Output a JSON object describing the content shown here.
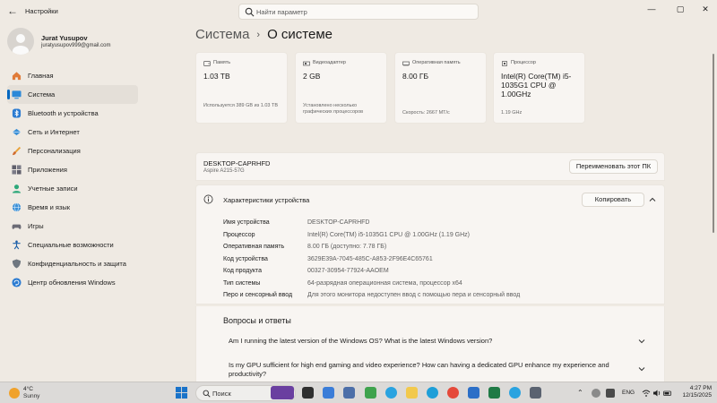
{
  "titlebar": {
    "app_title": "Настройки",
    "search_placeholder": "Найти параметр"
  },
  "profile": {
    "name": "Jurat Yusupov",
    "email": "juratyusupov999@gmail.com"
  },
  "sidebar": {
    "items": [
      {
        "label": "Главная",
        "icon": "home-icon"
      },
      {
        "label": "Система",
        "icon": "system-icon",
        "active": true
      },
      {
        "label": "Bluetooth и устройства",
        "icon": "bluetooth-icon"
      },
      {
        "label": "Сеть и Интернет",
        "icon": "network-icon"
      },
      {
        "label": "Персонализация",
        "icon": "brush-icon"
      },
      {
        "label": "Приложения",
        "icon": "apps-icon"
      },
      {
        "label": "Учетные записи",
        "icon": "accounts-icon"
      },
      {
        "label": "Время и язык",
        "icon": "globe-icon"
      },
      {
        "label": "Игры",
        "icon": "gamepad-icon"
      },
      {
        "label": "Специальные возможности",
        "icon": "accessibility-icon"
      },
      {
        "label": "Конфиденциальность и защита",
        "icon": "shield-icon"
      },
      {
        "label": "Центр обновления Windows",
        "icon": "update-icon"
      }
    ]
  },
  "breadcrumb": {
    "parent": "Система",
    "separator": "›",
    "current": "О системе"
  },
  "cards": [
    {
      "label": "Память",
      "value": "1.03 TB",
      "sub": "Используется 389 GB из 1.03 TB",
      "icon": "storage-icon"
    },
    {
      "label": "Видеоадаптер",
      "value": "2 GB",
      "sub": "Установлено несколько графических процессоров",
      "icon": "gpu-icon"
    },
    {
      "label": "Оперативная память",
      "value": "8.00 ГБ",
      "sub": "Скорость: 2667 МТ/с",
      "icon": "ram-icon"
    },
    {
      "label": "Процессор",
      "value": "Intel(R) Core(TM) i5-1035G1 CPU @ 1.00GHz",
      "sub": "1.19 GHz",
      "icon": "cpu-icon"
    }
  ],
  "device": {
    "name": "DESKTOP-CAPRHFD",
    "model": "Aspire A215-57G",
    "rename_button": "Переименовать этот ПК"
  },
  "specs": {
    "title": "Характеристики устройства",
    "copy_button": "Копировать",
    "rows": [
      {
        "key": "Имя устройства",
        "value": "DESKTOP-CAPRHFD"
      },
      {
        "key": "Процессор",
        "value": "Intel(R) Core(TM) i5-1035G1 CPU @ 1.00GHz (1.19 GHz)"
      },
      {
        "key": "Оперативная память",
        "value": "8.00 ГБ (доступно: 7.78 ГБ)"
      },
      {
        "key": "Код устройства",
        "value": "3629E39A-7045-485C-A853-2F96E4C65761"
      },
      {
        "key": "Код продукта",
        "value": "00327-30954-77924-AAOEM"
      },
      {
        "key": "Тип системы",
        "value": "64-разрядная операционная система, процессор x64"
      },
      {
        "key": "Перо и сенсорный ввод",
        "value": "Для этого монитора недоступен ввод с помощью пера и сенсорный ввод"
      }
    ]
  },
  "faq": {
    "title": "Вопросы и ответы",
    "questions": [
      "Am I running the latest version of the Windows OS? What is the latest Windows version?",
      "Is my GPU sufficient for high end gaming and video experience? How can having a dedicated GPU enhance my experience and productivity?"
    ]
  },
  "taskbar": {
    "weather_temp": "4°C",
    "weather_cond": "Sunny",
    "search_label": "Поиск",
    "lang": "ENG",
    "time": "4:27 PM",
    "date": "12/15/2025"
  },
  "colors": {
    "accent": "#0067c0",
    "background": "#efeae3",
    "card": "#f8f5f2"
  }
}
